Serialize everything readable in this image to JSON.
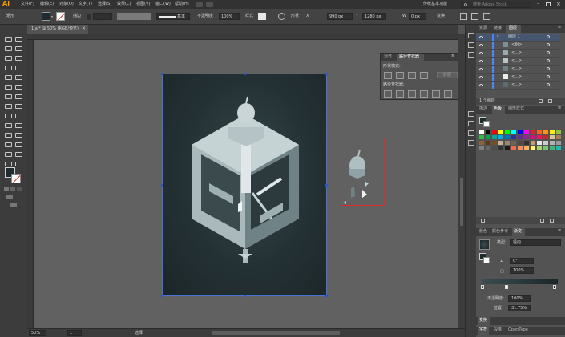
{
  "app": {
    "logo": "Ai"
  },
  "menubar": {
    "items": [
      "文件(F)",
      "编辑(E)",
      "对象(O)",
      "文字(T)",
      "选择(S)",
      "效果(C)",
      "视图(V)",
      "窗口(W)",
      "帮助(H)"
    ],
    "workspace": "传统基本功能",
    "search_placeholder": "搜索 Adobe Stock"
  },
  "control": {
    "selection_label": "矩形",
    "stroke_label": "描边",
    "stroke_width": "",
    "brush_label": "基本",
    "opacity_label": "不透明度",
    "opacity_value": "100%",
    "style_label": "样式",
    "shape_label": "形状",
    "x_label": "X",
    "x_value": "990 px",
    "y_label": "Y",
    "y_value": "1280 px",
    "w_label": "W",
    "w_value": "0 px",
    "transform_label": "变换"
  },
  "document": {
    "tab_title": "1.ai* @ 50% (RGB/预览)",
    "close": "×"
  },
  "status": {
    "zoom": "50%",
    "page": "1",
    "tool_name": "选择"
  },
  "pathfinder": {
    "tabs": [
      "对齐",
      "路径查找器"
    ],
    "shape_modes_label": "形状模式:",
    "expand_label": "扩展",
    "pathfinders_label": "路径查找器:"
  },
  "layers_panel": {
    "tabs": [
      "资源",
      "链接",
      "图层"
    ],
    "layers": [
      {
        "name": "图层 1"
      },
      {
        "name": "<组>"
      },
      {
        "name": "<...>"
      },
      {
        "name": "<...>"
      },
      {
        "name": "<...>"
      },
      {
        "name": "<...>"
      },
      {
        "name": "<...>"
      }
    ],
    "footer": "1 个图层"
  },
  "swatches_panel": {
    "tabs": [
      "描边",
      "色板",
      "图形样式"
    ],
    "colors": [
      "#ffffff",
      "#000000",
      "#ff0000",
      "#ffff00",
      "#00ff00",
      "#00ffff",
      "#0000ff",
      "#ff00ff",
      "#ed1c24",
      "#f26522",
      "#f7941d",
      "#fff200",
      "#8dc63f",
      "#39b54a",
      "#00a651",
      "#00a99d",
      "#00aeef",
      "#0072bc",
      "#2e3192",
      "#662d91",
      "#92278f",
      "#ec008c",
      "#ed145b",
      "#c1272d",
      "#d4c890",
      "#a67c52",
      "#8c6239",
      "#603913",
      "#754c24",
      "#c7b299",
      "#998675",
      "#736357",
      "#534741",
      "#362f2d",
      "#c69c6d",
      "#e6e6e6",
      "#cccccc",
      "#b3b3b3",
      "#999999",
      "#808080",
      "#666666",
      "#4d4d4d",
      "#333333",
      "#1a1a1a",
      "#f26c4f",
      "#f68e56",
      "#fbaf5d",
      "#fff568",
      "#acd373",
      "#7cc576",
      "#3bb878",
      "#1abbb4"
    ]
  },
  "gradient_panel": {
    "tabs": [
      "颜色",
      "颜色参考",
      "渐变"
    ],
    "type_label": "类型:",
    "type_value": "径向",
    "angle_value": "0°",
    "aspect_value": "100%",
    "opacity_label": "不透明度:",
    "opacity_value": "100%",
    "location_label": "位置:",
    "location_value": "31.75%"
  },
  "bottom_panels": {
    "transform_tab": "变换",
    "char_tabs": [
      "字符",
      "段落",
      "OpenType"
    ]
  },
  "colors": {
    "selection": "#2f55c9",
    "highlight": "#e02a2a",
    "accent_logo": "#ff9a00"
  }
}
